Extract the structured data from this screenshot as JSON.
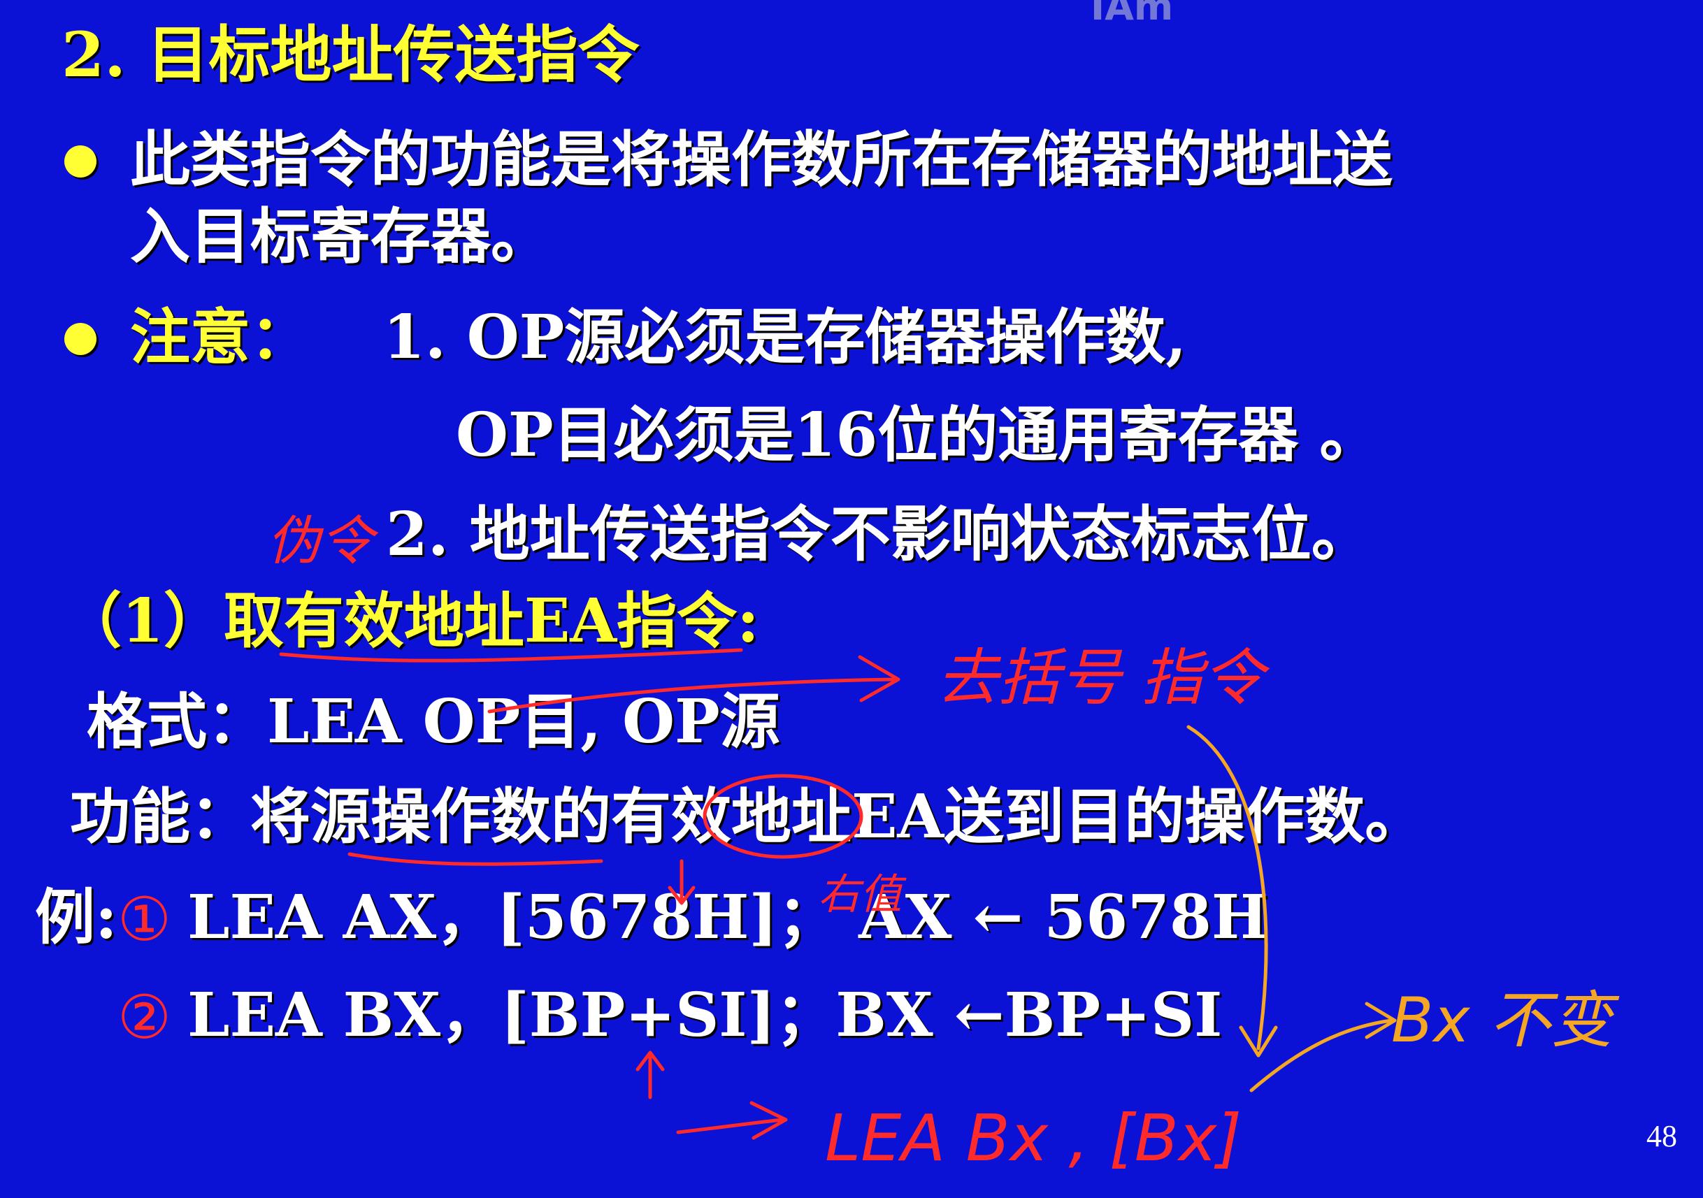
{
  "watermark": "IAm",
  "slide": {
    "title": "2. 目标地址传送指令",
    "bullet1_line1": "此类指令的功能是将操作数所在存储器的地址送",
    "bullet1_line2": "入目标寄存器。",
    "note_label": "注意：",
    "note1_line1": "1. OP源必须是存储器操作数,",
    "note1_line2": "OP目必须是16位的通用寄存器 。",
    "note2": "2.  地址传送指令不影响状态标志位。",
    "sub_heading": "（1）取有效地址EA指令:",
    "format_line": "格式：LEA  OP目, OP源",
    "function_line": "功能：将源操作数的有效地址EA送到目的操作数。",
    "example_label": "例:",
    "example1": "LEA   AX，[5678H]；    AX ← 5678H",
    "example2": "LEA    BX，[BP+SI]；BX ←BP+SI",
    "page_number": "48"
  },
  "annotations": {
    "note_prefix": "伪令",
    "fetch_address": "去括号 指令",
    "offset_value": "右值",
    "circle1": "①",
    "circle2": "②",
    "bx_unchanged": "Bx 不变",
    "lea_bx": "LEA  Bx , [Bx]"
  },
  "colors": {
    "background": "#0b12d6",
    "heading_yellow": "#ffff33",
    "body_white": "#ffffff",
    "ink_red": "#ff2a2a",
    "ink_orange": "#f5a623"
  }
}
